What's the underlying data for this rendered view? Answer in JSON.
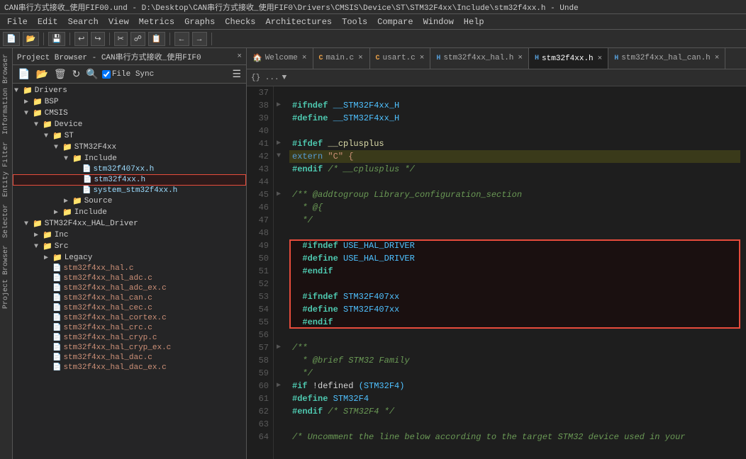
{
  "titlebar": {
    "text": "CAN串行方式接收_使用FIF00.und - D:\\Desktop\\CAN串行方式接收_使用FIF0\\Drivers\\CMSIS\\Device\\ST\\STM32F4xx\\Include\\stm32f4xx.h - Unde"
  },
  "menubar": {
    "items": [
      "File",
      "Edit",
      "Search",
      "View",
      "Metrics",
      "Graphs",
      "Checks",
      "Architectures",
      "Tools",
      "Compare",
      "Window",
      "Help"
    ]
  },
  "panel": {
    "header": "Project Browser - CAN串行方式接收_使用FIF0×",
    "filesync": "File Sync",
    "braces_label": "{} ..."
  },
  "sidebar_vtabs": [
    "Information Browser",
    "Entity Filter",
    "Selector",
    "Project Browser"
  ],
  "tree": [
    {
      "id": "drivers",
      "label": "Drivers",
      "type": "folder",
      "level": 0,
      "expanded": true
    },
    {
      "id": "bsp",
      "label": "BSP",
      "type": "folder",
      "level": 1,
      "expanded": false
    },
    {
      "id": "cmsis",
      "label": "CMSIS",
      "type": "folder",
      "level": 1,
      "expanded": true
    },
    {
      "id": "device",
      "label": "Device",
      "type": "folder",
      "level": 2,
      "expanded": true
    },
    {
      "id": "st",
      "label": "ST",
      "type": "folder",
      "level": 3,
      "expanded": true
    },
    {
      "id": "stm32f4xx",
      "label": "STM32F4xx",
      "type": "folder",
      "level": 4,
      "expanded": true
    },
    {
      "id": "include",
      "label": "Include",
      "type": "folder",
      "level": 5,
      "expanded": true
    },
    {
      "id": "stm32f407xx_h",
      "label": "stm32f407xx.h",
      "type": "file-h",
      "level": 6,
      "expanded": false
    },
    {
      "id": "stm32f4xx_h",
      "label": "stm32f4xx.h",
      "type": "file-h",
      "level": 6,
      "expanded": false,
      "selected": true,
      "highlighted": true
    },
    {
      "id": "system_stm32f4xx_h",
      "label": "system_stm32f4xx.h",
      "type": "file-h",
      "level": 6,
      "expanded": false
    },
    {
      "id": "source",
      "label": "Source",
      "type": "folder",
      "level": 5,
      "expanded": false
    },
    {
      "id": "include2",
      "label": "Include",
      "type": "folder",
      "level": 4,
      "expanded": false
    },
    {
      "id": "stm32f4xx_hal_driver",
      "label": "STM32F4xx_HAL_Driver",
      "type": "folder",
      "level": 1,
      "expanded": true
    },
    {
      "id": "inc",
      "label": "Inc",
      "type": "folder",
      "level": 2,
      "expanded": false
    },
    {
      "id": "src",
      "label": "Src",
      "type": "folder",
      "level": 2,
      "expanded": true
    },
    {
      "id": "legacy",
      "label": "Legacy",
      "type": "folder",
      "level": 3,
      "expanded": false
    },
    {
      "id": "stm32f4xx_hal_c",
      "label": "stm32f4xx_hal.c",
      "type": "file-c",
      "level": 3
    },
    {
      "id": "stm32f4xx_hal_adc_c",
      "label": "stm32f4xx_hal_adc.c",
      "type": "file-c",
      "level": 3
    },
    {
      "id": "stm32f4xx_hal_adc_ex_c",
      "label": "stm32f4xx_hal_adc_ex.c",
      "type": "file-c",
      "level": 3
    },
    {
      "id": "stm32f4xx_hal_can_c",
      "label": "stm32f4xx_hal_can.c",
      "type": "file-c",
      "level": 3
    },
    {
      "id": "stm32f4xx_hal_cec_c",
      "label": "stm32f4xx_hal_cec.c",
      "type": "file-c",
      "level": 3
    },
    {
      "id": "stm32f4xx_hal_cortex_c",
      "label": "stm32f4xx_hal_cortex.c",
      "type": "file-c",
      "level": 3
    },
    {
      "id": "stm32f4xx_hal_crc_c",
      "label": "stm32f4xx_hal_crc.c",
      "type": "file-c",
      "level": 3
    },
    {
      "id": "stm32f4xx_hal_cryp_c",
      "label": "stm32f4xx_hal_cryp.c",
      "type": "file-c",
      "level": 3
    },
    {
      "id": "stm32f4xx_hal_cryp_ex_c",
      "label": "stm32f4xx_hal_cryp_ex.c",
      "type": "file-c",
      "level": 3
    },
    {
      "id": "stm32f4xx_hal_dac_c",
      "label": "stm32f4xx_hal_dac.c",
      "type": "file-c",
      "level": 3
    },
    {
      "id": "stm32f4xx_hal_dac_ex_c",
      "label": "stm32f4xx_hal_dac_ex.c",
      "type": "file-c",
      "level": 3
    }
  ],
  "tabs": [
    {
      "label": "Welcome",
      "type": "welcome",
      "active": false,
      "closable": true
    },
    {
      "label": "main.c",
      "type": "c",
      "active": false,
      "closable": true
    },
    {
      "label": "usart.c",
      "type": "c",
      "active": false,
      "closable": true
    },
    {
      "label": "stm32f4xx_hal.h",
      "type": "h",
      "active": false,
      "closable": true
    },
    {
      "label": "stm32f4xx.h",
      "type": "h",
      "active": true,
      "closable": true
    },
    {
      "label": "stm32f4xx_hal_can.h",
      "type": "h",
      "active": false,
      "closable": true
    }
  ],
  "editor_toolbar": {
    "braces": "{} ..."
  },
  "code": {
    "lines": [
      {
        "num": 37,
        "content": "",
        "tokens": []
      },
      {
        "num": 38,
        "content": "#ifndef __STM32F4xx_H",
        "tokens": [
          {
            "text": "#ifndef",
            "class": "kw-preprocessor"
          },
          {
            "text": " __STM32F4xx_H",
            "class": "kw-macro"
          }
        ]
      },
      {
        "num": 39,
        "content": "#define __STM32F4xx_H",
        "tokens": [
          {
            "text": "#define",
            "class": "kw-preprocessor"
          },
          {
            "text": " __STM32F4xx_H",
            "class": "kw-macro"
          }
        ]
      },
      {
        "num": 40,
        "content": "",
        "tokens": []
      },
      {
        "num": 41,
        "content": "#ifdef __cplusplus",
        "tokens": [
          {
            "text": "#ifdef",
            "class": "kw-preprocessor"
          },
          {
            "text": " __cplusplus",
            "class": "kw-yellow"
          }
        ]
      },
      {
        "num": 42,
        "content": "extern \"C\" {",
        "tokens": [
          {
            "text": "extern",
            "class": "kw-extern"
          },
          {
            "text": " \"C\" {",
            "class": "kw-string"
          }
        ],
        "folded": true,
        "highlight_bg": "#3a3a2a"
      },
      {
        "num": 43,
        "content": "#endif /* __cplusplus */",
        "tokens": [
          {
            "text": "#endif",
            "class": "kw-preprocessor"
          },
          {
            "text": " /* __cplusplus */",
            "class": "kw-comment"
          }
        ]
      },
      {
        "num": 44,
        "content": "",
        "tokens": []
      },
      {
        "num": 45,
        "content": "/** @addtogroup Library_configuration_section",
        "tokens": [
          {
            "text": "/** @addtogroup Library_configuration_section",
            "class": "kw-green"
          }
        ]
      },
      {
        "num": 46,
        "content": "  * @{",
        "tokens": [
          {
            "text": "  * @{",
            "class": "kw-green"
          }
        ]
      },
      {
        "num": 47,
        "content": "  */",
        "tokens": [
          {
            "text": "  */",
            "class": "kw-green"
          }
        ]
      },
      {
        "num": 48,
        "content": "",
        "tokens": []
      },
      {
        "num": 49,
        "content": "  #ifndef USE_HAL_DRIVER",
        "tokens": [
          {
            "text": "  #ifndef",
            "class": "kw-preprocessor"
          },
          {
            "text": " USE_HAL_DRIVER",
            "class": "kw-macro"
          }
        ],
        "red_start": true
      },
      {
        "num": 50,
        "content": "  #define USE_HAL_DRIVER",
        "tokens": [
          {
            "text": "  #define",
            "class": "kw-preprocessor"
          },
          {
            "text": " USE_HAL_DRIVER",
            "class": "kw-macro"
          }
        ]
      },
      {
        "num": 51,
        "content": "  #endif",
        "tokens": [
          {
            "text": "  #endif",
            "class": "kw-preprocessor"
          }
        ]
      },
      {
        "num": 52,
        "content": "",
        "tokens": []
      },
      {
        "num": 53,
        "content": "  #ifndef STM32F407xx",
        "tokens": [
          {
            "text": "  #ifndef",
            "class": "kw-preprocessor"
          },
          {
            "text": " STM32F407xx",
            "class": "kw-macro"
          }
        ]
      },
      {
        "num": 54,
        "content": "  #define STM32F407xx",
        "tokens": [
          {
            "text": "  #define",
            "class": "kw-preprocessor"
          },
          {
            "text": " STM32F407xx",
            "class": "kw-macro"
          }
        ]
      },
      {
        "num": 55,
        "content": "  #endif",
        "tokens": [
          {
            "text": "  #endif",
            "class": "kw-preprocessor"
          }
        ],
        "red_end": true
      },
      {
        "num": 56,
        "content": "",
        "tokens": []
      },
      {
        "num": 57,
        "content": "/**",
        "tokens": [
          {
            "text": "/**",
            "class": "kw-green"
          }
        ]
      },
      {
        "num": 58,
        "content": "  * @brief STM32 Family",
        "tokens": [
          {
            "text": "  * @brief STM32 Family",
            "class": "kw-green"
          }
        ]
      },
      {
        "num": 59,
        "content": "  */",
        "tokens": [
          {
            "text": "  */",
            "class": "kw-green"
          }
        ]
      },
      {
        "num": 60,
        "content": "#if !defined (STM32F4)",
        "tokens": [
          {
            "text": "#if",
            "class": "kw-preprocessor"
          },
          {
            "text": " !defined ",
            "class": "text-white"
          },
          {
            "text": "(STM32F4)",
            "class": "kw-macro"
          }
        ]
      },
      {
        "num": 61,
        "content": "#define STM32F4",
        "tokens": [
          {
            "text": "#define",
            "class": "kw-preprocessor"
          },
          {
            "text": " STM32F4",
            "class": "kw-macro"
          }
        ]
      },
      {
        "num": 62,
        "content": "#endif /* STM32F4 */",
        "tokens": [
          {
            "text": "#endif",
            "class": "kw-preprocessor"
          },
          {
            "text": " /* STM32F4 */",
            "class": "kw-comment"
          }
        ]
      },
      {
        "num": 63,
        "content": "",
        "tokens": []
      },
      {
        "num": 64,
        "content": "/* Uncomment the line below according to the target STM32 device used in your",
        "tokens": [
          {
            "text": "/* Uncomment the line below according to the target STM32 device used in your",
            "class": "kw-comment"
          }
        ]
      }
    ]
  }
}
